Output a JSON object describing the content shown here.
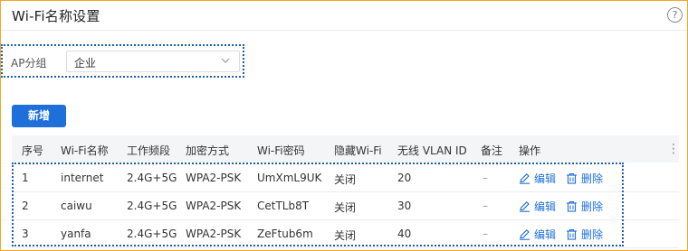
{
  "page": {
    "title": "Wi-Fi名称设置",
    "help_glyph": "?"
  },
  "filter": {
    "label": "AP分组",
    "selected": "企业"
  },
  "toolbar": {
    "add_label": "新增"
  },
  "table": {
    "columns": [
      "序号",
      "Wi-Fi名称",
      "工作频段",
      "加密方式",
      "Wi-Fi密码",
      "隐藏Wi-Fi",
      "无线 VLAN ID",
      "备注",
      "操作"
    ],
    "kebab_glyph": "⋮",
    "rows": [
      {
        "index": "1",
        "name": "internet",
        "band": "2.4G+5G",
        "encryption": "WPA2-PSK",
        "password": "UmXmL9UK",
        "hidden": "关闭",
        "vlan": "20",
        "remark": "–",
        "edit": "编辑",
        "delete": "删除"
      },
      {
        "index": "2",
        "name": "caiwu",
        "band": "2.4G+5G",
        "encryption": "WPA2-PSK",
        "password": "CetTLb8T",
        "hidden": "关闭",
        "vlan": "30",
        "remark": "–",
        "edit": "编辑",
        "delete": "删除"
      },
      {
        "index": "3",
        "name": "yanfa",
        "band": "2.4G+5G",
        "encryption": "WPA2-PSK",
        "password": "ZeFtub6m",
        "hidden": "关闭",
        "vlan": "40",
        "remark": "–",
        "edit": "编辑",
        "delete": "删除"
      }
    ]
  },
  "colors": {
    "accent": "#1e6fd9",
    "highlight_border": "#1b5fb0",
    "frame_border": "#f5a623"
  }
}
